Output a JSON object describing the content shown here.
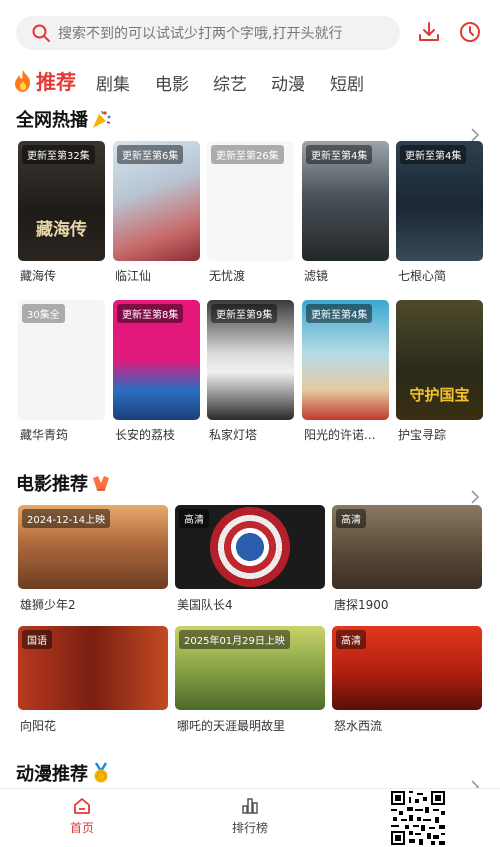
{
  "search": {
    "placeholder": "搜索不到的可以试试少打两个字哦,打开头就行"
  },
  "header_icons": [
    "download-icon",
    "history-icon"
  ],
  "colors": {
    "accent": "#e53935",
    "tab_text": "#444444",
    "search_bg": "#f2f2f2"
  },
  "tabs": [
    {
      "label": "推荐",
      "active": true
    },
    {
      "label": "剧集"
    },
    {
      "label": "电影"
    },
    {
      "label": "综艺"
    },
    {
      "label": "动漫"
    },
    {
      "label": "短剧"
    }
  ],
  "sections": {
    "hot": {
      "title": "全网热播",
      "items": [
        {
          "badge": "更新至第32集",
          "title": "藏海传",
          "poster_text": "藏海传"
        },
        {
          "badge": "更新至第6集",
          "title": "临江仙",
          "poster_text": ""
        },
        {
          "badge": "更新至第26集",
          "title": "无忧渡",
          "poster_text": ""
        },
        {
          "badge": "更新至第4集",
          "title": "滤镜",
          "poster_text": ""
        },
        {
          "badge": "更新至第4集",
          "title": "七根心简",
          "poster_text": ""
        },
        {
          "badge": "30集全",
          "title": "藏华青筠",
          "poster_text": ""
        },
        {
          "badge": "更新至第8集",
          "title": "长安的荔枝",
          "poster_text": ""
        },
        {
          "badge": "更新至第9集",
          "title": "私家灯塔",
          "poster_text": ""
        },
        {
          "badge": "更新至第4集",
          "title": "阳光的许诺...",
          "poster_text": ""
        },
        {
          "badge": "",
          "title": "护宝寻踪",
          "poster_text": "守护国宝"
        }
      ]
    },
    "movies": {
      "title": "电影推荐",
      "items": [
        {
          "badge": "2024-12-14上映",
          "title": "雄狮少年2"
        },
        {
          "badge": "高清",
          "title": "美国队长4"
        },
        {
          "badge": "高清",
          "title": "唐探1900"
        },
        {
          "badge": "国语",
          "title": "向阳花"
        },
        {
          "badge": "2025年01月29日上映",
          "title": "哪吒的天涯最明故里"
        },
        {
          "badge": "高清",
          "title": "怒水西流"
        }
      ]
    },
    "anime": {
      "title": "动漫推荐"
    }
  },
  "bottom_nav": [
    {
      "label": "首页",
      "active": true
    },
    {
      "label": "排行榜",
      "active": false
    }
  ]
}
